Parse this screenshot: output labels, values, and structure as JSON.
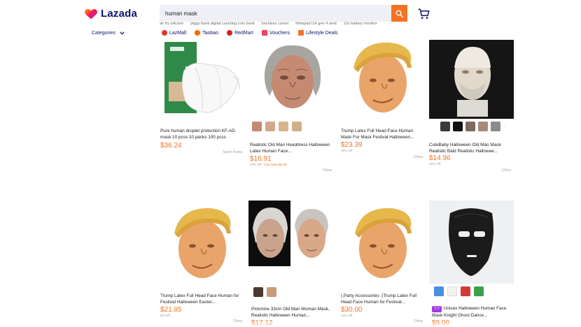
{
  "brand": {
    "name": "Lazada"
  },
  "search": {
    "value": "human mask"
  },
  "suggestions": [
    "air fry silicone",
    "piggy bank digital counting coin bank",
    "backless corset",
    "thinkpad t14 gen 4 amd",
    "12v battery monitor"
  ],
  "nav": {
    "categories_label": "Categories",
    "links": [
      {
        "label": "LazMall",
        "color": "#e6322f"
      },
      {
        "label": "Taobao",
        "color": "#ff6a00"
      },
      {
        "label": "RedMart",
        "color": "#d71e28"
      },
      {
        "label": "Vouchers",
        "color": "#f23f63"
      },
      {
        "label": "Lifestyle Deals",
        "color": "#f57224"
      }
    ]
  },
  "colors": {
    "accent": "#f57224",
    "brand": "#0f136d",
    "search_bg": "#eff0f5"
  },
  "products": [
    {
      "title": "Pure human droplet protection KF-AD mask 10 pcss 10 packs 100 pcss",
      "price": "$36.24",
      "location": "South Korea"
    },
    {
      "title": "Realistic Old Man Headdress Halloween Latex Human Face...",
      "price": "$16.91",
      "discount": "33% Off",
      "coin_save": "Coin save $0.85",
      "location": "China"
    },
    {
      "title": "Trump Latex Full Head Face Human Mask For Mask Festival Halloween...",
      "price": "$23.39",
      "discount": "16% Off",
      "location": "China"
    },
    {
      "title": "CuteBaby Halloween Old Man Mask Realistic Bald Realistic Hallowee...",
      "price": "$14.96",
      "discount": "45% Off",
      "location": "China"
    },
    {
      "title": "Trump Latex Full Head Face Human for Festival Halloween Easter...",
      "price": "$21.85",
      "discount": "5% Off",
      "location": "China"
    },
    {
      "title": "Pickmine 33cm Old Man Woman Mask, Realistic Halloween Human...",
      "price": "$17.12"
    },
    {
      "title": "(.Party Accessories .)Trump Latex Full Head Face Human for Festival...",
      "price": "$30.00",
      "discount": "44% Off",
      "location": "China"
    },
    {
      "badge": "7.7",
      "title": "Unisex Halloween Human Face Mask Knight Ghost Dance...",
      "price": "$9.00"
    }
  ]
}
